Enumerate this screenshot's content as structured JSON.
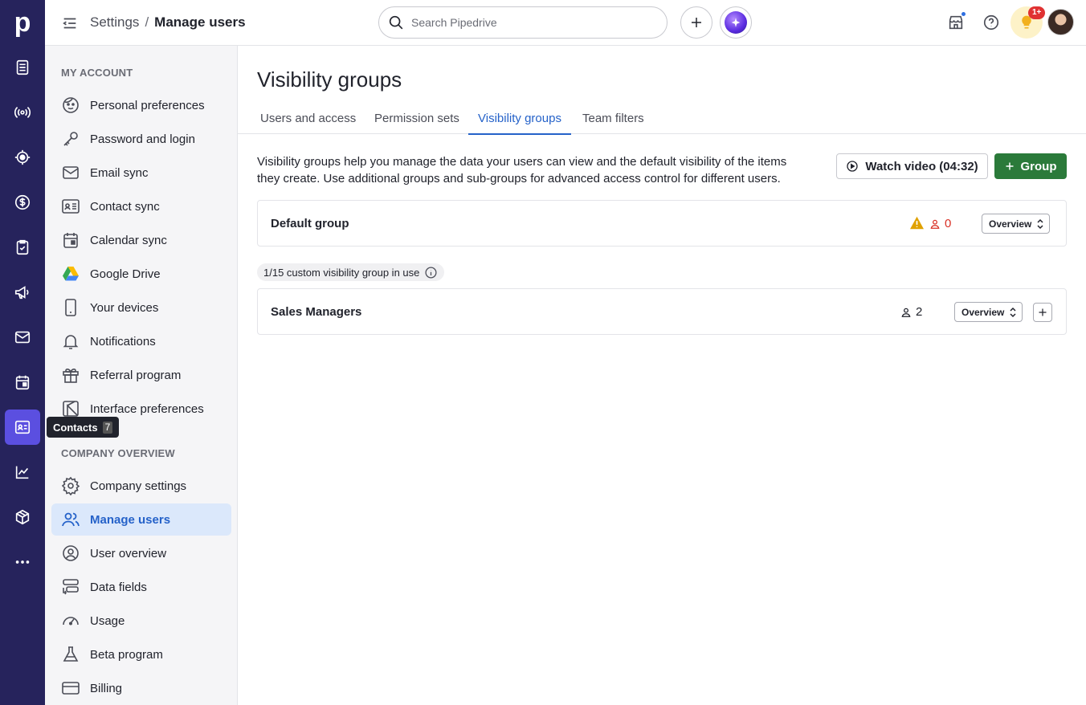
{
  "app": {
    "logo": "p"
  },
  "rail": {
    "tooltip": {
      "label": "Contacts",
      "count": "7"
    },
    "items": [
      "leads-icon",
      "broadcast-icon",
      "target-icon",
      "deals-icon",
      "activities-check-icon",
      "campaigns-megaphone-icon",
      "mail-icon",
      "calendar-icon",
      "contacts-icon",
      "insights-chart-icon",
      "products-box-icon",
      "more-icon"
    ]
  },
  "topbar": {
    "crumb_parent": "Settings",
    "crumb_sep": "/",
    "crumb_current": "Manage users",
    "search_placeholder": "Search Pipedrive",
    "notif_badge": "1+"
  },
  "sidebar": {
    "my_account_title": "MY ACCOUNT",
    "my_account": [
      {
        "label": "Personal preferences",
        "icon": "face-icon"
      },
      {
        "label": "Password and login",
        "icon": "key-icon"
      },
      {
        "label": "Email sync",
        "icon": "envelope-icon"
      },
      {
        "label": "Contact sync",
        "icon": "contact-card-icon"
      },
      {
        "label": "Calendar sync",
        "icon": "calendar-icon"
      },
      {
        "label": "Google Drive",
        "icon": "google-drive-icon"
      },
      {
        "label": "Your devices",
        "icon": "phone-icon"
      },
      {
        "label": "Notifications",
        "icon": "bell-icon"
      },
      {
        "label": "Referral program",
        "icon": "gift-icon"
      },
      {
        "label": "Interface preferences",
        "icon": "interface-icon"
      }
    ],
    "company_title": "COMPANY OVERVIEW",
    "company": [
      {
        "label": "Company settings",
        "icon": "gear-icon"
      },
      {
        "label": "Manage users",
        "icon": "users-icon"
      },
      {
        "label": "User overview",
        "icon": "user-circle-icon"
      },
      {
        "label": "Data fields",
        "icon": "data-fields-icon"
      },
      {
        "label": "Usage",
        "icon": "gauge-icon"
      },
      {
        "label": "Beta program",
        "icon": "flask-icon"
      },
      {
        "label": "Billing",
        "icon": "credit-card-icon"
      }
    ]
  },
  "main": {
    "title": "Visibility groups",
    "tabs": [
      "Users and access",
      "Permission sets",
      "Visibility groups",
      "Team filters"
    ],
    "active_tab": "Visibility groups",
    "description": "Visibility groups help you manage the data your users can view and the default visibility of the items they create. Use additional groups and sub-groups for advanced access control for different users.",
    "watch_video": "Watch video (04:32)",
    "add_group": "Group",
    "default_group": {
      "name": "Default group",
      "users": "0",
      "view": "Overview"
    },
    "usage": "1/15 custom visibility group in use",
    "groups": [
      {
        "name": "Sales Managers",
        "users": "2",
        "view": "Overview"
      }
    ]
  },
  "colors": {
    "rail": "#26235c",
    "accent": "#2562c9",
    "green": "#2b7a3a",
    "warning": "#e0a100",
    "danger": "#d93025"
  }
}
